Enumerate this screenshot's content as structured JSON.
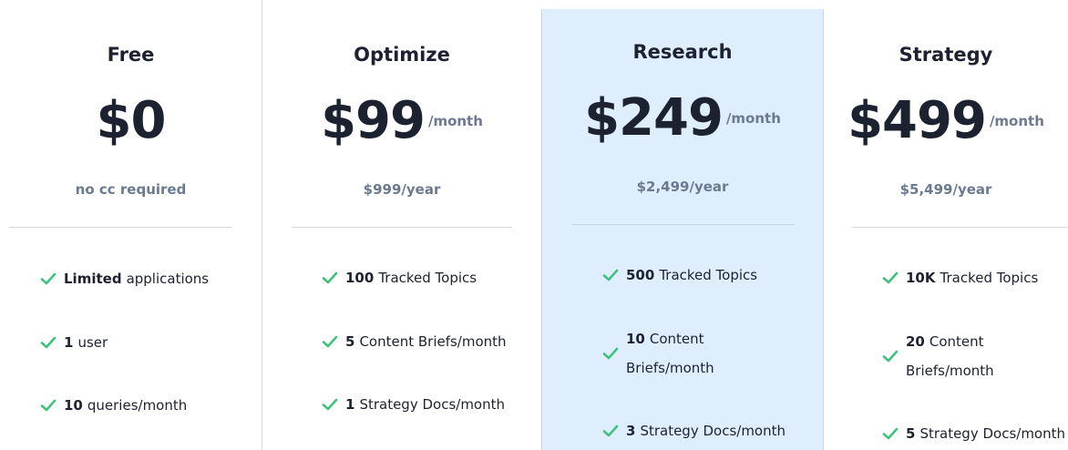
{
  "colors": {
    "accent_bg": "#dfeefd",
    "check": "#3ec27d",
    "muted": "#6b7a90"
  },
  "plans": [
    {
      "name": "Free",
      "price": "$0",
      "period": "",
      "sub": "no cc required",
      "features": [
        {
          "bold": "Limited",
          "text": "applications"
        },
        {
          "bold": "1",
          "text": "user"
        },
        {
          "bold": "10",
          "text": "queries/month"
        }
      ]
    },
    {
      "name": "Optimize",
      "price": "$99",
      "period": "/month",
      "sub": "$999/year",
      "features": [
        {
          "bold": "100",
          "text": "Tracked Topics"
        },
        {
          "bold": "5",
          "text": "Content Briefs/month"
        },
        {
          "bold": "1",
          "text": "Strategy Docs/month"
        }
      ]
    },
    {
      "name": "Research",
      "price": "$249",
      "period": "/month",
      "sub": "$2,499/year",
      "features": [
        {
          "bold": "500",
          "text": "Tracked Topics"
        },
        {
          "bold": "10",
          "text": "Content",
          "text2": "Briefs/month"
        },
        {
          "bold": "3",
          "text": "Strategy Docs/month"
        }
      ]
    },
    {
      "name": "Strategy",
      "price": "$499",
      "period": "/month",
      "sub": "$5,499/year",
      "features": [
        {
          "bold": "10K",
          "text": "Tracked Topics"
        },
        {
          "bold": "20",
          "text": "Content",
          "text2": "Briefs/month"
        },
        {
          "bold": "5",
          "text": "Strategy Docs/month"
        }
      ]
    }
  ]
}
